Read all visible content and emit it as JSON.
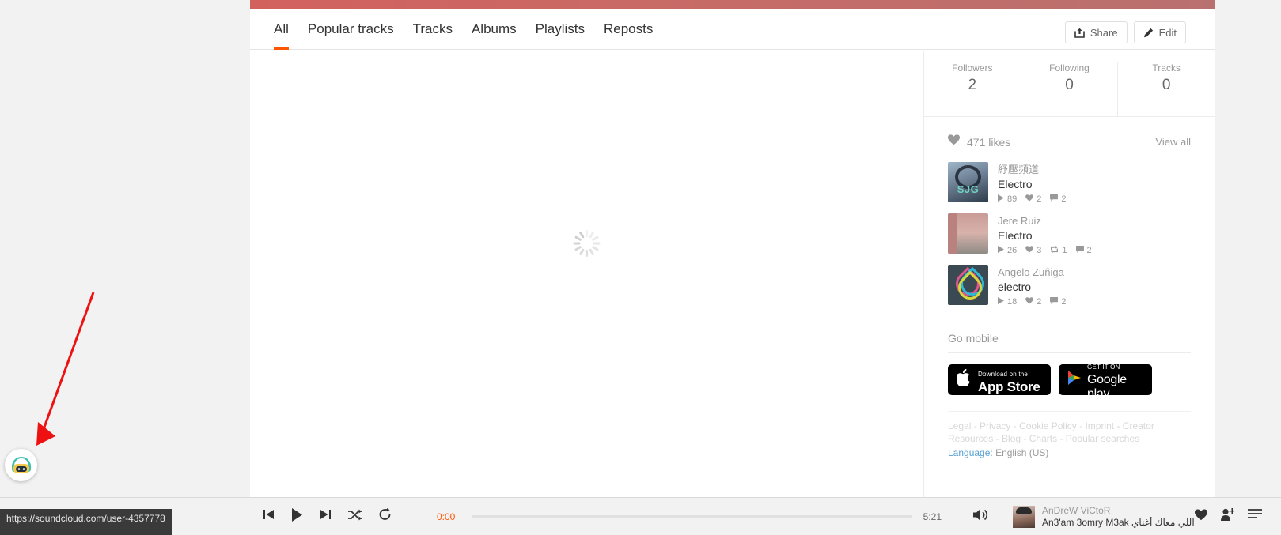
{
  "tabs": [
    {
      "label": "All",
      "active": true
    },
    {
      "label": "Popular tracks",
      "active": false
    },
    {
      "label": "Tracks",
      "active": false
    },
    {
      "label": "Albums",
      "active": false
    },
    {
      "label": "Playlists",
      "active": false
    },
    {
      "label": "Reposts",
      "active": false
    }
  ],
  "header": {
    "share_label": "Share",
    "edit_label": "Edit"
  },
  "stats": [
    {
      "label": "Followers",
      "value": "2"
    },
    {
      "label": "Following",
      "value": "0"
    },
    {
      "label": "Tracks",
      "value": "0"
    }
  ],
  "likes": {
    "count_label": "471 likes",
    "view_all_label": "View all",
    "tracks": [
      {
        "user": "紓壓頻道",
        "title": "Electro",
        "plays": "89",
        "likes": "2",
        "reposts": null,
        "comments": "2"
      },
      {
        "user": "Jere Ruiz",
        "title": "Electro",
        "plays": "26",
        "likes": "3",
        "reposts": "1",
        "comments": "2"
      },
      {
        "user": "Angelo Zuñiga",
        "title": "electro",
        "plays": "18",
        "likes": "2",
        "reposts": null,
        "comments": "2"
      }
    ]
  },
  "go_mobile": {
    "label": "Go mobile",
    "app_store": {
      "line1": "Download on the",
      "line2": "App Store"
    },
    "google_play": {
      "line1": "GET IT ON",
      "line2": "Google play"
    }
  },
  "footer": {
    "links": [
      "Legal",
      "Privacy",
      "Cookie Policy",
      "Imprint",
      "Creator Resources",
      "Blog",
      "Charts",
      "Popular searches"
    ],
    "separator": " - ",
    "language_label": "Language:",
    "language_value": "English (US)"
  },
  "player": {
    "current_time": "0:00",
    "duration": "5:21",
    "now_playing_user": "AnDreW ViCtoR",
    "now_playing_title": "An3'am 3omry M3ak اللي معاك أغناي",
    "accent_color": "#ff5500"
  },
  "status_bar": {
    "url": "https://soundcloud.com/user-4357778"
  },
  "chat_widget": {
    "name": "chat-avatar"
  }
}
